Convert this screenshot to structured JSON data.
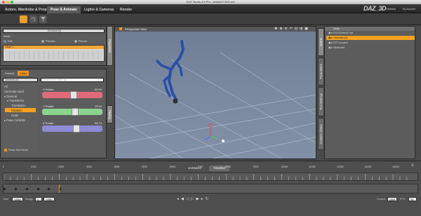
{
  "window": {
    "title": "DAZ Studio 4.5 Pro - ANIMATIONS.duf"
  },
  "menu": {
    "tabs": [
      "Actors, Wardrobe & Props",
      "Pose & Animate",
      "Lights & Cameras",
      "Render"
    ],
    "active_tab": "Pose & Animate",
    "brand_pre": "DAZ",
    "brand_post": "3D",
    "feedback": "Feedback",
    "my_account": "My Account"
  },
  "puppeteer": {
    "node_select": "Genesis (2)",
    "mode_label": "Mode :",
    "modes": [
      "Edit",
      "Preview",
      "Record"
    ],
    "layer": "Layer 1",
    "side_tab": "Puppeteer"
  },
  "parameters": {
    "tabs": [
      "Presets",
      "Editor"
    ],
    "active_tab": "Editor",
    "node_select": "Genesis (2)",
    "filter_placeholder": "Enter text to filter by...",
    "tree": [
      "All",
      "Currently Used",
      "General",
      "Transforms",
      "Translation",
      "Rotation",
      "Scale",
      "Pose Controls"
    ],
    "selected_item": "Rotation",
    "show_sub_items": "Show Sub Items",
    "side_tab": "Posing",
    "sliders": [
      {
        "label": "X Rotate",
        "value": "-36.90",
        "color": "#e06b7a",
        "position": 0.53
      },
      {
        "label": "Y Rotate",
        "value": "15.94",
        "color": "#8bd48f",
        "position": 0.55
      },
      {
        "label": "Z Rotate",
        "value": "98.73",
        "color": "#8e8ad8",
        "position": 0.58
      }
    ]
  },
  "viewport": {
    "camera": "Perspective View",
    "colors": {
      "background": "#7886a0",
      "figure": "#2a4fa8"
    }
  },
  "scene": {
    "header": "Node",
    "items": [
      "DAZ/Default Hat",
      "Genesis (2)",
      "GST-project",
      "MotionArt"
    ],
    "selected": "Genesis (2)",
    "side_tabs": [
      "Scene",
      "Parameters",
      "Tool Settings",
      "Content Library"
    ],
    "active_side_tab": "Scene"
  },
  "timeline": {
    "tabs": [
      "aniMate2",
      "Timeline"
    ],
    "active_tab": "Timeline",
    "ticks": [
      "0",
      "1000",
      "2000",
      "3000",
      "4000",
      "5000",
      "6000",
      "7000",
      "8000",
      "9000",
      "10000",
      "11000",
      "12000",
      "13000",
      "14000"
    ],
    "total_label": "Total:",
    "total": "14882",
    "range_label": "Range:",
    "range_start": "0",
    "range_end": "14881",
    "current_label": "Current:",
    "current": "2000",
    "fps_label": "FPS:",
    "fps": "30",
    "playhead_frame": 2000
  },
  "colors": {
    "accent": "#f7941d",
    "selection": "#f6a21e"
  }
}
